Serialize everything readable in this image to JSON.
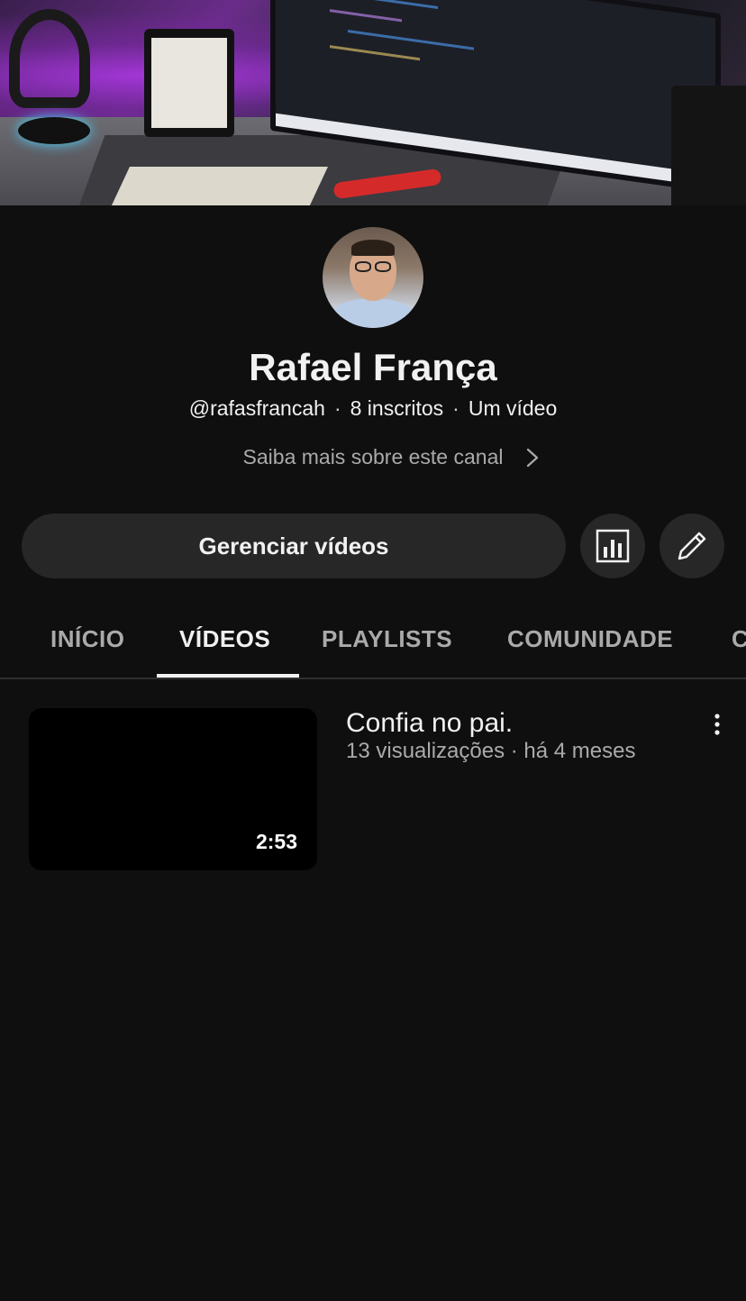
{
  "channel": {
    "name": "Rafael França",
    "handle": "@rafasfrancah",
    "subscribers": "8 inscritos",
    "videos_count": "Um vídeo",
    "separator": "·",
    "about_link": "Saiba mais sobre este canal"
  },
  "actions": {
    "manage_videos": "Gerenciar vídeos",
    "stats_icon": "bar-chart-icon",
    "edit_icon": "pencil-icon"
  },
  "tabs": [
    {
      "label": "INÍCIO",
      "active": false
    },
    {
      "label": "VÍDEOS",
      "active": true
    },
    {
      "label": "PLAYLISTS",
      "active": false
    },
    {
      "label": "COMUNIDADE",
      "active": false
    },
    {
      "label": "C",
      "active": false
    }
  ],
  "videos": [
    {
      "title": "Confia no pai.",
      "meta": "13 visualizações · há 4 meses",
      "duration": "2:53"
    }
  ],
  "colors": {
    "background": "#0f0f0f",
    "button": "#272727",
    "text_primary": "#f1f1f1",
    "text_secondary": "#aaaaaa"
  }
}
